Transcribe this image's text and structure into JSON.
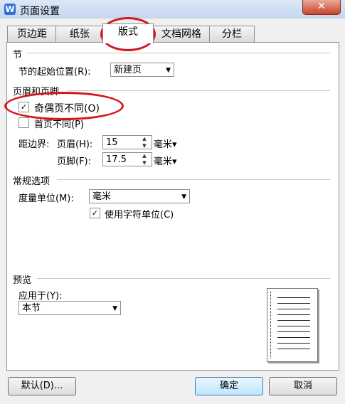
{
  "window": {
    "app_icon": "W",
    "title": "页面设置",
    "close": "✕"
  },
  "tabs": [
    {
      "label": "页边距"
    },
    {
      "label": "纸张"
    },
    {
      "label": "版式",
      "active": true
    },
    {
      "label": "文档网格"
    },
    {
      "label": "分栏"
    }
  ],
  "section": {
    "group": "节",
    "start_label": "节的起始位置(R):",
    "start_value": "新建页"
  },
  "header_footer": {
    "group": "页眉和页脚",
    "odd_even_label": "奇偶页不同(O)",
    "odd_even_checked": true,
    "first_page_label": "首页不同(P)",
    "first_page_checked": false,
    "distance_label": "距边界:",
    "header_label": "页眉(H):",
    "header_value": "15",
    "footer_label": "页脚(F):",
    "footer_value": "17.5",
    "unit": "毫米"
  },
  "general": {
    "group": "常规选项",
    "measure_label": "度量单位(M):",
    "measure_value": "毫米",
    "char_units_label": "使用字符单位(C)",
    "char_units_checked": true
  },
  "preview": {
    "group": "预览",
    "apply_label": "应用于(Y):",
    "apply_value": "本节"
  },
  "buttons": {
    "default": "默认(D)...",
    "ok": "确定",
    "cancel": "取消"
  },
  "glyphs": {
    "check": "✓",
    "dropdown": "▼",
    "spin_up": "▲",
    "spin_down": "▼",
    "unit_arrow": "▾"
  },
  "colors": {
    "annotation": "#d6141b",
    "title_bar": "#c3d7ee",
    "close": "#c7432b"
  }
}
